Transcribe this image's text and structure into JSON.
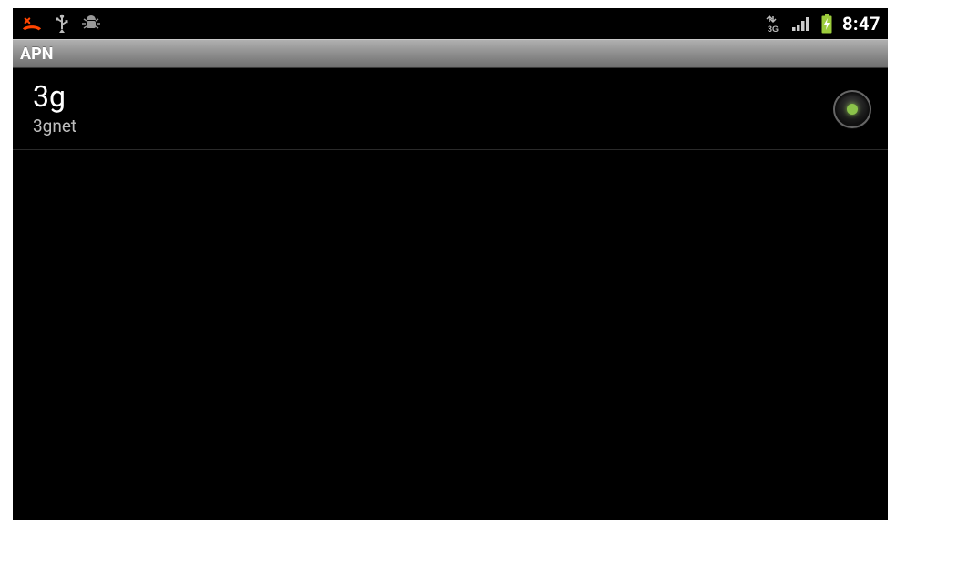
{
  "status_bar": {
    "time": "8:47",
    "icons": {
      "missed_call": "missed-call",
      "usb": "usb",
      "debug": "android-debug",
      "network_3g": "3G",
      "signal": "signal",
      "battery": "battery-charging"
    }
  },
  "title_bar": {
    "title": "APN"
  },
  "apn_list": [
    {
      "name": "3g",
      "apn": "3gnet",
      "selected": true
    }
  ],
  "colors": {
    "accent_green": "#8bc34a",
    "battery_green": "#9ccc3c"
  }
}
